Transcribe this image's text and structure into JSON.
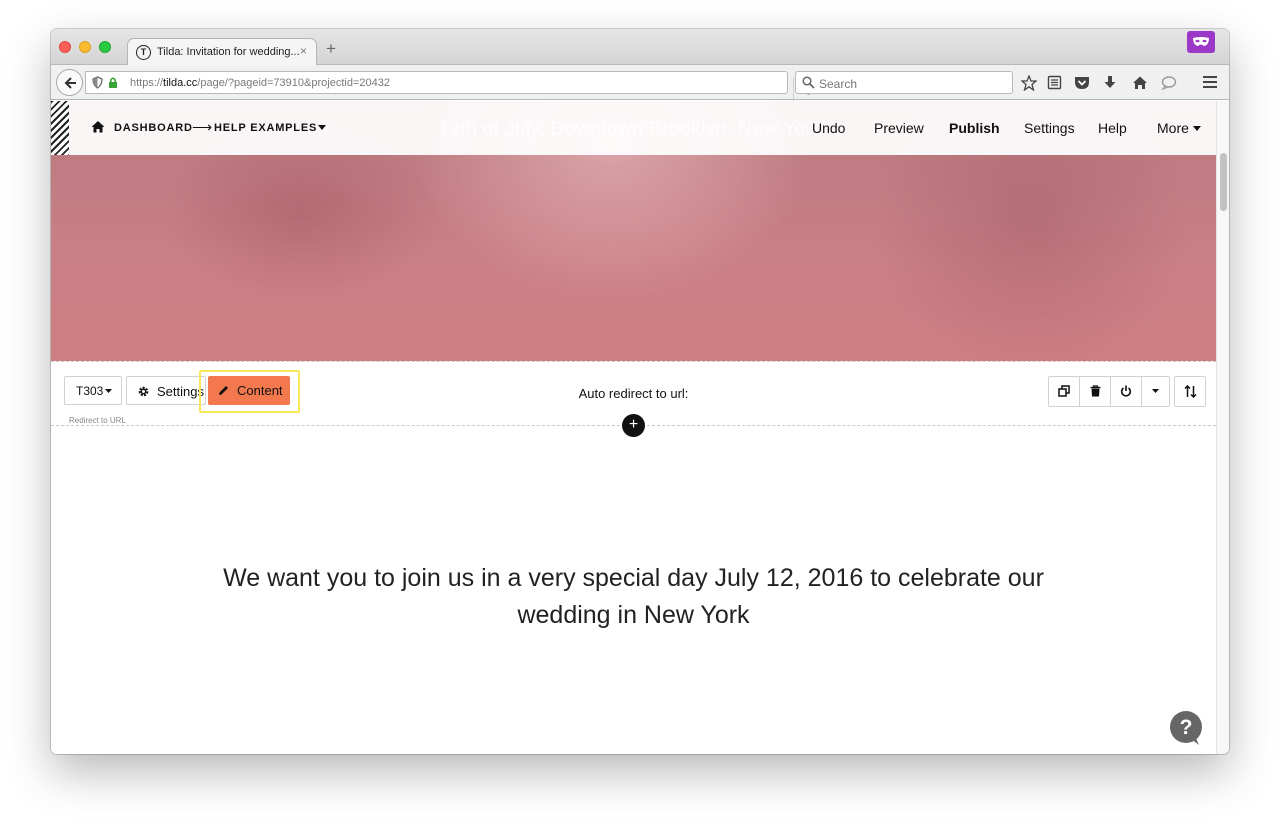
{
  "browser": {
    "tab_title": "Tilda: Invitation for wedding...",
    "tab_close": "×",
    "new_tab": "+",
    "favicon_letter": "T",
    "url_prefix": "https://",
    "url_host": "tilda.cc",
    "url_path": "/page/?pageid=73910&projectid=20432",
    "search_placeholder": "Search"
  },
  "tilda_header": {
    "breadcrumb_dashboard": "DASHBOARD",
    "breadcrumb_arrow": "⟶",
    "breadcrumb_project": "HELP EXAMPLES",
    "hero_text_behind": "12th of July, Downtown Brooklyn, New York",
    "menu": {
      "undo": "Undo",
      "preview": "Preview",
      "publish": "Publish",
      "settings": "Settings",
      "help": "Help",
      "more": "More"
    }
  },
  "block_toolbar": {
    "block_code": "T303",
    "settings_label": "Settings",
    "content_label": "Content",
    "block_name": "Redirect to URL",
    "block_title": "Auto redirect to url:",
    "add_block": "+"
  },
  "content": {
    "invitation_text": "We want you to join us in a very special day July 12, 2016 to celebrate our wedding in New York"
  },
  "colors": {
    "accent_content_button": "#f4784e",
    "highlight": "#f6e85a",
    "hero_overlay": "#c98086",
    "extension": "#9b38c7"
  },
  "icons": [
    "home-icon",
    "caret-down-icon",
    "gear-icon",
    "pencil-icon",
    "duplicate-icon",
    "trash-icon",
    "power-icon",
    "sort-icon",
    "help-icon",
    "search-icon",
    "reload-icon",
    "back-arrow-icon",
    "lock-icon",
    "shield-icon",
    "star-icon",
    "reading-list-icon",
    "pocket-icon",
    "download-icon",
    "home-browser-icon",
    "chat-icon",
    "menu-icon",
    "mask-icon"
  ]
}
